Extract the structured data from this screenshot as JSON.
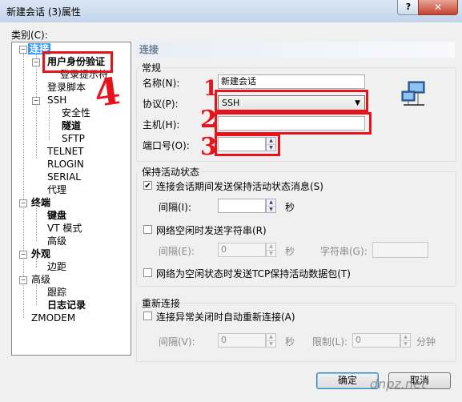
{
  "window": {
    "title": "新建会话 (3)属性",
    "help": "?",
    "close": "✕"
  },
  "category_label": "类别(C):",
  "tree": {
    "connection": "连接",
    "user_auth": "用户身份验证",
    "login_prompts": "登录提示符",
    "login_script": "登录脚本",
    "ssh": "SSH",
    "security": "安全性",
    "tunnel": "隧道",
    "sftp": "SFTP",
    "telnet": "TELNET",
    "rlogin": "RLOGIN",
    "serial": "SERIAL",
    "proxy": "代理",
    "terminal": "终端",
    "keyboard": "键盘",
    "vt_mode": "VT 模式",
    "advanced": "高级",
    "appearance": "外观",
    "margin": "边距",
    "advanced2": "高级",
    "trace": "跟踪",
    "logging": "日志记录",
    "zmodem": "ZMODEM"
  },
  "panel": {
    "title": "连接",
    "general": {
      "legend": "常规",
      "name_label": "名称(N):",
      "name_value": "新建会话",
      "protocol_label": "协议(P):",
      "protocol_value": "SSH",
      "host_label": "主机(H):",
      "host_value": "",
      "port_label": "端口号(O):",
      "port_value": ""
    },
    "keepalive": {
      "legend": "保持活动状态",
      "send_keepalive": "连接会话期间发送保持活动状态消息(S)",
      "send_keepalive_checked": true,
      "interval_label": "间隔(I):",
      "interval_value": "",
      "seconds": "秒",
      "send_string": "网络空闲时发送字符串(R)",
      "interval2_label": "间隔(E):",
      "interval2_value": "0",
      "seconds2": "秒",
      "string_label": "字符串(G):",
      "string_value": "",
      "tcp_keepalive": "网络为空闲状态时发送TCP保持活动数据包(T)"
    },
    "reconnect": {
      "legend": "重新连接",
      "auto_reconnect": "连接异常关闭时自动重新连接(A)",
      "interval_label": "间隔(V):",
      "interval_value": "0",
      "seconds": "秒",
      "limit_label": "限制(L):",
      "limit_value": "0",
      "minutes": "分钟"
    }
  },
  "buttons": {
    "ok": "确定",
    "cancel": "取消"
  },
  "annotations": {
    "mark1": "1",
    "mark2": "2",
    "mark3": "3",
    "mark4": "4"
  },
  "watermark": "dnpz.net",
  "colors": {
    "annotation_red": "#e8121c",
    "selection": "#3399ff"
  }
}
